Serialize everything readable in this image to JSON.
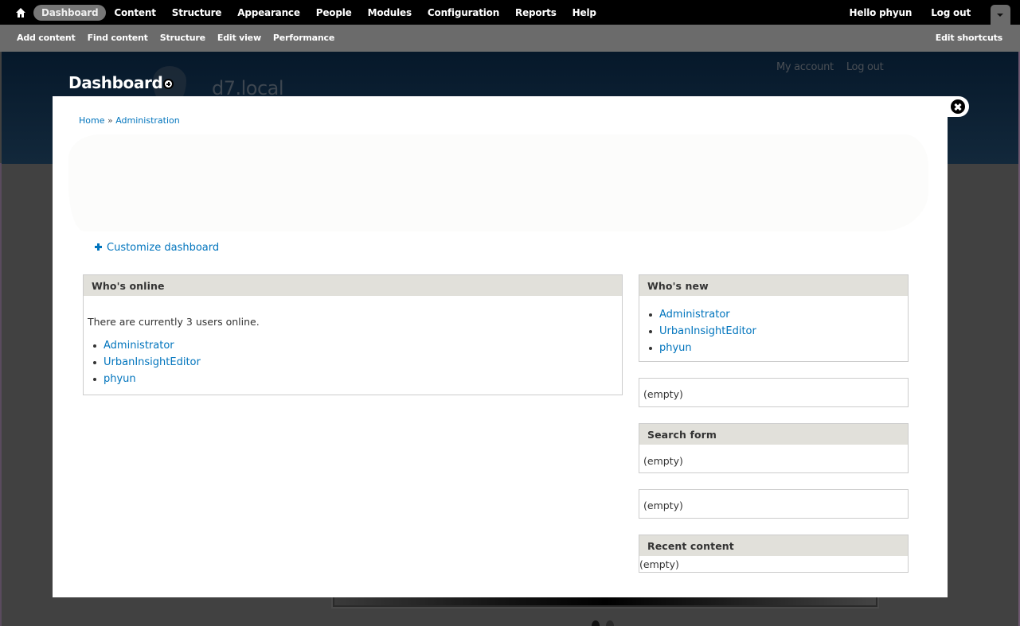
{
  "toolbar": {
    "home_icon": "home-icon",
    "menu": [
      {
        "label": "Dashboard",
        "active": true
      },
      {
        "label": "Content"
      },
      {
        "label": "Structure"
      },
      {
        "label": "Appearance"
      },
      {
        "label": "People"
      },
      {
        "label": "Modules"
      },
      {
        "label": "Configuration"
      },
      {
        "label": "Reports"
      },
      {
        "label": "Help"
      }
    ],
    "greeting": "Hello phyun",
    "logout": "Log out",
    "toggle_icon": "chevron-down-icon"
  },
  "shortcuts": {
    "links": [
      "Add content",
      "Find content",
      "Structure",
      "Edit view",
      "Performance"
    ],
    "edit": "Edit shortcuts"
  },
  "page_header": {
    "title": "Dashboard",
    "add_shortcut_icon": "plus-circle-icon",
    "site_name": "d7.local",
    "secondary_menu": [
      "My account",
      "Log out"
    ]
  },
  "overlay": {
    "close_icon": "close-icon",
    "breadcrumb": {
      "home": "Home",
      "separator": "»",
      "current": "Administration"
    },
    "customize_label": "Customize dashboard",
    "blocks": {
      "whos_online": {
        "title": "Who's online",
        "summary": "There are currently 3 users online.",
        "users": [
          "Administrator",
          "UrbanInsightEditor",
          "phyun"
        ]
      },
      "whos_new": {
        "title": "Who's new",
        "users": [
          "Administrator",
          "UrbanInsightEditor",
          "phyun"
        ]
      },
      "untitled_1": {
        "content": "(empty)"
      },
      "search_form": {
        "title": "Search form",
        "content": "(empty)"
      },
      "untitled_2": {
        "content": "(empty)"
      },
      "recent_content": {
        "title": "Recent content",
        "content": "(empty)"
      }
    }
  },
  "colors": {
    "link": "#0074bd",
    "toolbar_bg": "#000000",
    "shortcut_bg": "#6b6b6b",
    "active_tab": "#777777",
    "block_header": "#e1e0da",
    "header_bg": "#06182a"
  }
}
